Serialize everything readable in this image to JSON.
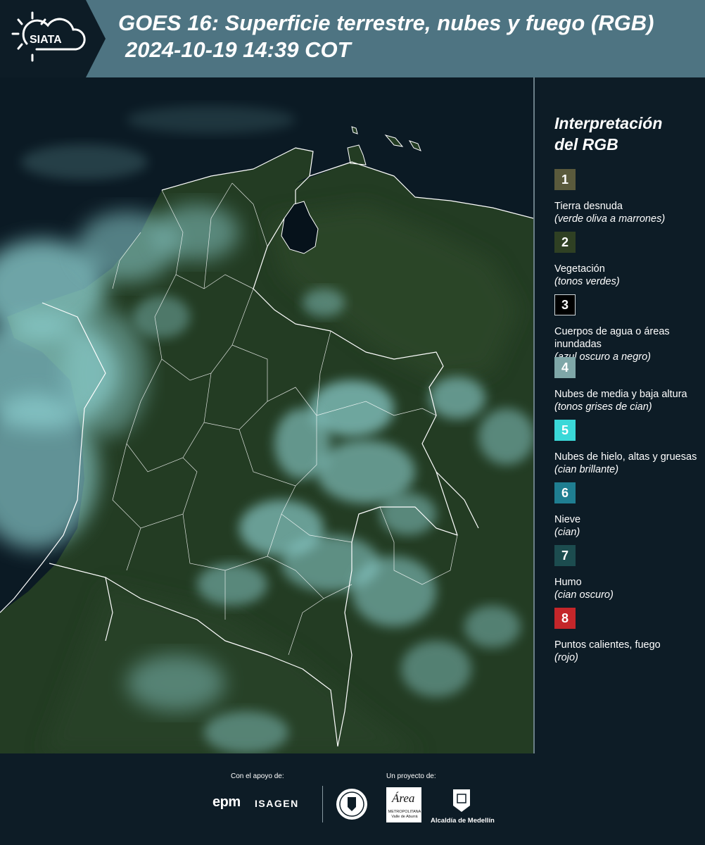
{
  "header": {
    "logo_text": "SIATA",
    "title_line1": "GOES 16: Superficie terrestre, nubes y fuego (RGB)",
    "title_line2": "2024-10-19 14:39 COT"
  },
  "legend": {
    "title_line1": "Interpretación",
    "title_line2": "del RGB",
    "items": [
      {
        "number": "1",
        "color": "#5a5a3c",
        "border": "#5a5a3c",
        "label": "Tierra desnuda",
        "hint": "(verde oliva a marrones)"
      },
      {
        "number": "2",
        "color": "#2f4023",
        "border": "#2f4023",
        "label": "Vegetación",
        "hint": "(tonos verdes)"
      },
      {
        "number": "3",
        "color": "#000000",
        "border": "#cfd6d9",
        "label": "Cuerpos de agua o áreas inundadas",
        "hint": "(azul oscuro a negro)"
      },
      {
        "number": "4",
        "color": "#7fa7a8",
        "border": "#7fa7a8",
        "label": "Nubes de media y baja altura",
        "hint": "(tonos grises de cian)"
      },
      {
        "number": "5",
        "color": "#3ad8d8",
        "border": "#3ad8d8",
        "label": "Nubes de hielo, altas y gruesas",
        "hint": "(cian brillante)"
      },
      {
        "number": "6",
        "color": "#1f7e91",
        "border": "#1f7e91",
        "label": "Nieve",
        "hint": "(cian)"
      },
      {
        "number": "7",
        "color": "#1c4c4f",
        "border": "#1c4c4f",
        "label": "Humo",
        "hint": "(cian oscuro)"
      },
      {
        "number": "8",
        "color": "#c4262a",
        "border": "#c4262a",
        "label": "Puntos calientes, fuego",
        "hint": "(rojo)"
      }
    ]
  },
  "footer": {
    "support_label": "Con el apoyo de:",
    "project_label": "Un proyecto de:",
    "sponsor_epm": "epm",
    "sponsor_isagen": "ISAGEN",
    "area_word": "Área",
    "area_sub": "METROPOLITANA Valle de Aburrá",
    "alcaldia_label": "Alcaldía de Medellín"
  },
  "colors": {
    "header_bg": "#4e7482",
    "page_bg": "#0d1c26",
    "land": "#243d24",
    "ocean": "#0b1a24",
    "cloud": "#8fd3d3"
  }
}
